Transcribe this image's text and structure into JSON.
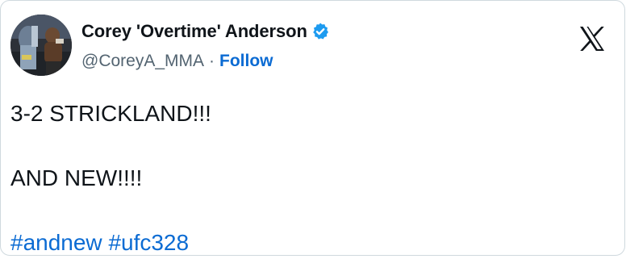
{
  "tweet": {
    "author": {
      "display_name": "Corey 'Overtime' Anderson",
      "handle": "@CoreyA_MMA",
      "separator": "·",
      "follow_label": "Follow",
      "verified": true,
      "verified_icon": "verified-badge-icon",
      "avatar_icon": "avatar"
    },
    "text_lines": [
      "3-2 STRICKLAND!!!",
      "AND NEW!!!!"
    ],
    "hashtags": [
      "#andnew",
      "#ufc328"
    ],
    "platform_icon": "x-logo-icon"
  },
  "colors": {
    "link": "#0b6bd3",
    "verified": "#1d9bf0",
    "text": "#0f1419",
    "secondary_text": "#536471",
    "border": "#cfd9de"
  }
}
